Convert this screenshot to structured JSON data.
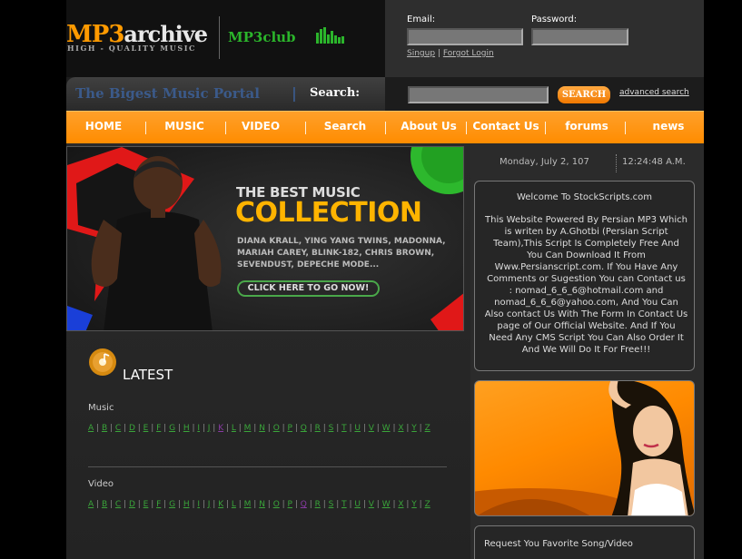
{
  "logo": {
    "mp3": "MP3",
    "archive": "archive",
    "tagline": "HIGH - QUALITY MUSIC",
    "club": "MP3club"
  },
  "login": {
    "email_label": "Email:",
    "password_label": "Password:",
    "signup": "Singup",
    "separator": "|",
    "forgot": "Forgot Login"
  },
  "searchbar": {
    "slogan": "The Bigest Music Portal",
    "slogan_sep": "|",
    "search_label": "Search:",
    "button": "SEARCH",
    "advanced": "advanced search"
  },
  "nav": [
    "HOME",
    "MUSIC",
    "VIDEO",
    "Search",
    "About Us",
    "Contact Us",
    "forums",
    "news"
  ],
  "banner": {
    "line1": "THE BEST MUSIC",
    "line2": "COLLECTION",
    "artists": "DIANA KRALL, YING YANG TWINS, MADONNA, MARIAH CAREY, BLINK-182, CHRIS BROWN, SEVENDUST, DEPECHE MODE...",
    "cta": "CLICK HERE TO GO NOW!"
  },
  "latest": {
    "title": "LATEST",
    "music_label": "Music",
    "video_label": "Video",
    "letters": [
      "A",
      "B",
      "C",
      "D",
      "E",
      "F",
      "G",
      "H",
      "I",
      "J",
      "K",
      "L",
      "M",
      "N",
      "O",
      "P",
      "Q",
      "R",
      "S",
      "T",
      "U",
      "V",
      "W",
      "X",
      "Y",
      "Z"
    ]
  },
  "sidebar": {
    "date": "Monday, July 2, 107",
    "time": "12:24:48 A.M.",
    "welcome_title": "Welcome To StockScripts.com",
    "welcome_text": "This Website Powered By Persian MP3 Which is writen by A.Ghotbi (Persian Script Team),This Script Is Completely Free And You Can Download It From Www.Persianscript.com. If You Have Any Comments or Sugestion You can Contact us : nomad_6_6_6@hotmail.com and nomad_6_6_6@yahoo.com, And You Can Also contact Us With The Form In Contact Us page of Our Official Website. And If You Need Any CMS Script You Can Also Order It And We Will Do It For Free!!!",
    "request_title": "Request You Favorite Song/Video"
  },
  "colors": {
    "accent": "#ff8c00",
    "link": "#3aa53a",
    "visited": "#8a3aa5"
  }
}
